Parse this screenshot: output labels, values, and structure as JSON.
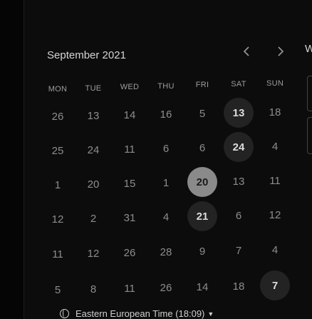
{
  "calendar": {
    "month_label": "September 2021",
    "prev_icon": "chevron-left-icon",
    "next_icon": "chevron-right-icon",
    "side_label": "W",
    "weekdays": [
      "MON",
      "TUE",
      "WED",
      "THU",
      "FRI",
      "SAT",
      "SUN"
    ],
    "weeks": [
      [
        {
          "n": "26"
        },
        {
          "n": "13"
        },
        {
          "n": "14"
        },
        {
          "n": "16"
        },
        {
          "n": "5"
        },
        {
          "n": "13",
          "state": "highlight"
        },
        {
          "n": "18"
        }
      ],
      [
        {
          "n": "25"
        },
        {
          "n": "24"
        },
        {
          "n": "11"
        },
        {
          "n": "6"
        },
        {
          "n": "6"
        },
        {
          "n": "24",
          "state": "highlight"
        },
        {
          "n": "4"
        }
      ],
      [
        {
          "n": "1"
        },
        {
          "n": "20"
        },
        {
          "n": "15"
        },
        {
          "n": "1"
        },
        {
          "n": "20",
          "state": "selected"
        },
        {
          "n": "13"
        },
        {
          "n": "11"
        }
      ],
      [
        {
          "n": "12"
        },
        {
          "n": "2"
        },
        {
          "n": "31"
        },
        {
          "n": "4"
        },
        {
          "n": "21",
          "state": "highlight"
        },
        {
          "n": "6"
        },
        {
          "n": "12"
        }
      ],
      [
        {
          "n": "11"
        },
        {
          "n": "12"
        },
        {
          "n": "26"
        },
        {
          "n": "28"
        },
        {
          "n": "9"
        },
        {
          "n": "7"
        },
        {
          "n": "4"
        }
      ],
      [
        {
          "n": "5"
        },
        {
          "n": "8"
        },
        {
          "n": "11"
        },
        {
          "n": "26"
        },
        {
          "n": "14"
        },
        {
          "n": "18"
        },
        {
          "n": "7",
          "state": "highlight"
        }
      ]
    ]
  },
  "timezone": {
    "icon": "globe-icon",
    "label": "Eastern European Time (18:09)",
    "caret_icon": "caret-down-icon"
  },
  "colors": {
    "background": "#0c0c0c",
    "highlight": "#232323",
    "selected": "#8a8a8a"
  }
}
